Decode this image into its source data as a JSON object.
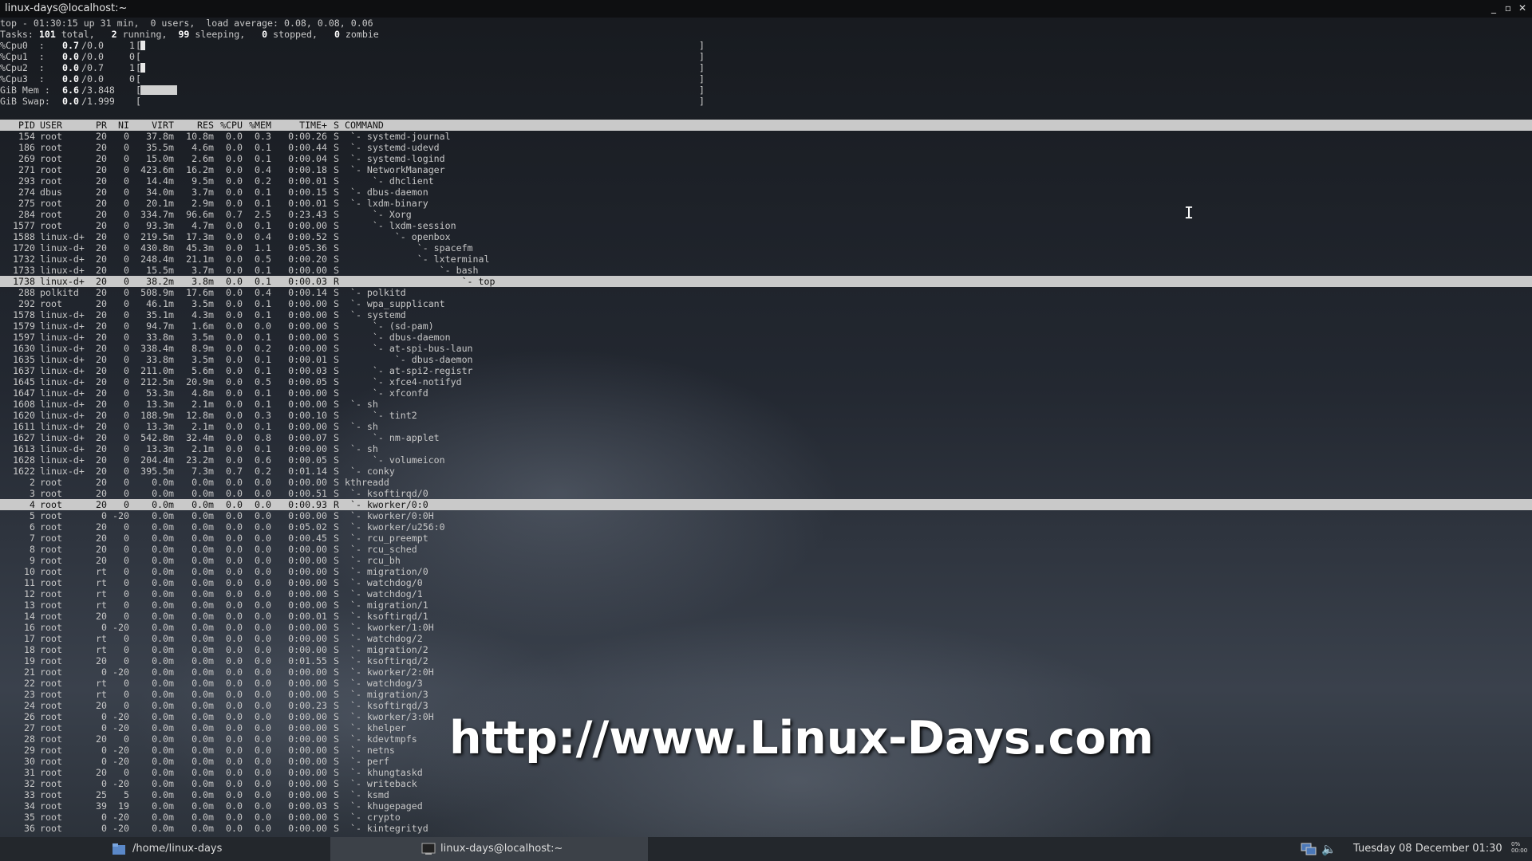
{
  "window": {
    "title": "linux-days@localhost:~"
  },
  "summary": {
    "line1": "top - 01:30:15 up 31 min,  0 users,  load average: 0.08, 0.08, 0.06",
    "tasks_label": "Tasks:",
    "tasks_total": "101",
    "tasks_total_label": "total,",
    "tasks_running": "2",
    "tasks_running_label": "running,",
    "tasks_sleeping": "99",
    "tasks_sleeping_label": "sleeping,",
    "tasks_stopped": "0",
    "tasks_stopped_label": "stopped,",
    "tasks_zombie": "0",
    "tasks_zombie_label": "zombie",
    "cpus": [
      {
        "label": "%Cpu0  :",
        "val": "0.7",
        "rest": "/0.0",
        "n": "1",
        "usage": 0.7
      },
      {
        "label": "%Cpu1  :",
        "val": "0.0",
        "rest": "/0.0",
        "n": "0",
        "usage": 0.0
      },
      {
        "label": "%Cpu2  :",
        "val": "0.0",
        "rest": "/0.7",
        "n": "1",
        "usage": 0.7
      },
      {
        "label": "%Cpu3  :",
        "val": "0.0",
        "rest": "/0.0",
        "n": "0",
        "usage": 0.0
      }
    ],
    "mem": {
      "label": "GiB Mem :",
      "val": "6.6",
      "rest": "/3.848",
      "usage_pct": 6.6
    },
    "swap": {
      "label": "GiB Swap:",
      "val": "0.0",
      "rest": "/1.999",
      "usage_pct": 0.0
    },
    "bracket_open": "[",
    "bracket_close": "]"
  },
  "columns": [
    "PID",
    "USER",
    "PR",
    "NI",
    "VIRT",
    "RES",
    "%CPU",
    "%MEM",
    "TIME+",
    "S",
    "COMMAND"
  ],
  "processes": [
    [
      "154",
      "root",
      "20",
      "0",
      "37.8m",
      "10.8m",
      "0.0",
      "0.3",
      "0:00.26",
      "S",
      " `- systemd-journal"
    ],
    [
      "186",
      "root",
      "20",
      "0",
      "35.5m",
      "4.6m",
      "0.0",
      "0.1",
      "0:00.44",
      "S",
      " `- systemd-udevd"
    ],
    [
      "269",
      "root",
      "20",
      "0",
      "15.0m",
      "2.6m",
      "0.0",
      "0.1",
      "0:00.04",
      "S",
      " `- systemd-logind"
    ],
    [
      "271",
      "root",
      "20",
      "0",
      "423.6m",
      "16.2m",
      "0.0",
      "0.4",
      "0:00.18",
      "S",
      " `- NetworkManager"
    ],
    [
      "293",
      "root",
      "20",
      "0",
      "14.4m",
      "9.5m",
      "0.0",
      "0.2",
      "0:00.01",
      "S",
      "     `- dhclient"
    ],
    [
      "274",
      "dbus",
      "20",
      "0",
      "34.0m",
      "3.7m",
      "0.0",
      "0.1",
      "0:00.15",
      "S",
      " `- dbus-daemon"
    ],
    [
      "275",
      "root",
      "20",
      "0",
      "20.1m",
      "2.9m",
      "0.0",
      "0.1",
      "0:00.01",
      "S",
      " `- lxdm-binary"
    ],
    [
      "284",
      "root",
      "20",
      "0",
      "334.7m",
      "96.6m",
      "0.7",
      "2.5",
      "0:23.43",
      "S",
      "     `- Xorg"
    ],
    [
      "1577",
      "root",
      "20",
      "0",
      "93.3m",
      "4.7m",
      "0.0",
      "0.1",
      "0:00.00",
      "S",
      "     `- lxdm-session"
    ],
    [
      "1588",
      "linux-d+",
      "20",
      "0",
      "219.5m",
      "17.3m",
      "0.0",
      "0.4",
      "0:00.52",
      "S",
      "         `- openbox"
    ],
    [
      "1720",
      "linux-d+",
      "20",
      "0",
      "430.8m",
      "45.3m",
      "0.0",
      "1.1",
      "0:05.36",
      "S",
      "             `- spacefm"
    ],
    [
      "1732",
      "linux-d+",
      "20",
      "0",
      "248.4m",
      "21.1m",
      "0.0",
      "0.5",
      "0:00.20",
      "S",
      "             `- lxterminal"
    ],
    [
      "1733",
      "linux-d+",
      "20",
      "0",
      "15.5m",
      "3.7m",
      "0.0",
      "0.1",
      "0:00.00",
      "S",
      "                 `- bash"
    ],
    [
      "1738",
      "linux-d+",
      "20",
      "0",
      "38.2m",
      "3.8m",
      "0.0",
      "0.1",
      "0:00.03",
      "R",
      "                     `- top"
    ],
    [
      "288",
      "polkitd",
      "20",
      "0",
      "508.9m",
      "17.6m",
      "0.0",
      "0.4",
      "0:00.14",
      "S",
      " `- polkitd"
    ],
    [
      "292",
      "root",
      "20",
      "0",
      "46.1m",
      "3.5m",
      "0.0",
      "0.1",
      "0:00.00",
      "S",
      " `- wpa_supplicant"
    ],
    [
      "1578",
      "linux-d+",
      "20",
      "0",
      "35.1m",
      "4.3m",
      "0.0",
      "0.1",
      "0:00.00",
      "S",
      " `- systemd"
    ],
    [
      "1579",
      "linux-d+",
      "20",
      "0",
      "94.7m",
      "1.6m",
      "0.0",
      "0.0",
      "0:00.00",
      "S",
      "     `- (sd-pam)"
    ],
    [
      "1597",
      "linux-d+",
      "20",
      "0",
      "33.8m",
      "3.5m",
      "0.0",
      "0.1",
      "0:00.00",
      "S",
      "     `- dbus-daemon"
    ],
    [
      "1630",
      "linux-d+",
      "20",
      "0",
      "338.4m",
      "8.9m",
      "0.0",
      "0.2",
      "0:00.00",
      "S",
      "     `- at-spi-bus-laun"
    ],
    [
      "1635",
      "linux-d+",
      "20",
      "0",
      "33.8m",
      "3.5m",
      "0.0",
      "0.1",
      "0:00.01",
      "S",
      "         `- dbus-daemon"
    ],
    [
      "1637",
      "linux-d+",
      "20",
      "0",
      "211.0m",
      "5.6m",
      "0.0",
      "0.1",
      "0:00.03",
      "S",
      "     `- at-spi2-registr"
    ],
    [
      "1645",
      "linux-d+",
      "20",
      "0",
      "212.5m",
      "20.9m",
      "0.0",
      "0.5",
      "0:00.05",
      "S",
      "     `- xfce4-notifyd"
    ],
    [
      "1647",
      "linux-d+",
      "20",
      "0",
      "53.3m",
      "4.8m",
      "0.0",
      "0.1",
      "0:00.00",
      "S",
      "     `- xfconfd"
    ],
    [
      "1608",
      "linux-d+",
      "20",
      "0",
      "13.3m",
      "2.1m",
      "0.0",
      "0.1",
      "0:00.00",
      "S",
      " `- sh"
    ],
    [
      "1620",
      "linux-d+",
      "20",
      "0",
      "188.9m",
      "12.8m",
      "0.0",
      "0.3",
      "0:00.10",
      "S",
      "     `- tint2"
    ],
    [
      "1611",
      "linux-d+",
      "20",
      "0",
      "13.3m",
      "2.1m",
      "0.0",
      "0.1",
      "0:00.00",
      "S",
      " `- sh"
    ],
    [
      "1627",
      "linux-d+",
      "20",
      "0",
      "542.8m",
      "32.4m",
      "0.0",
      "0.8",
      "0:00.07",
      "S",
      "     `- nm-applet"
    ],
    [
      "1613",
      "linux-d+",
      "20",
      "0",
      "13.3m",
      "2.1m",
      "0.0",
      "0.1",
      "0:00.00",
      "S",
      " `- sh"
    ],
    [
      "1628",
      "linux-d+",
      "20",
      "0",
      "204.4m",
      "23.2m",
      "0.0",
      "0.6",
      "0:00.05",
      "S",
      "     `- volumeicon"
    ],
    [
      "1622",
      "linux-d+",
      "20",
      "0",
      "395.5m",
      "7.3m",
      "0.7",
      "0.2",
      "0:01.14",
      "S",
      " `- conky"
    ],
    [
      "2",
      "root",
      "20",
      "0",
      "0.0m",
      "0.0m",
      "0.0",
      "0.0",
      "0:00.00",
      "S",
      "kthreadd"
    ],
    [
      "3",
      "root",
      "20",
      "0",
      "0.0m",
      "0.0m",
      "0.0",
      "0.0",
      "0:00.51",
      "S",
      " `- ksoftirqd/0"
    ],
    [
      "4",
      "root",
      "20",
      "0",
      "0.0m",
      "0.0m",
      "0.0",
      "0.0",
      "0:00.93",
      "R",
      " `- kworker/0:0"
    ],
    [
      "5",
      "root",
      "0",
      "-20",
      "0.0m",
      "0.0m",
      "0.0",
      "0.0",
      "0:00.00",
      "S",
      " `- kworker/0:0H"
    ],
    [
      "6",
      "root",
      "20",
      "0",
      "0.0m",
      "0.0m",
      "0.0",
      "0.0",
      "0:05.02",
      "S",
      " `- kworker/u256:0"
    ],
    [
      "7",
      "root",
      "20",
      "0",
      "0.0m",
      "0.0m",
      "0.0",
      "0.0",
      "0:00.45",
      "S",
      " `- rcu_preempt"
    ],
    [
      "8",
      "root",
      "20",
      "0",
      "0.0m",
      "0.0m",
      "0.0",
      "0.0",
      "0:00.00",
      "S",
      " `- rcu_sched"
    ],
    [
      "9",
      "root",
      "20",
      "0",
      "0.0m",
      "0.0m",
      "0.0",
      "0.0",
      "0:00.00",
      "S",
      " `- rcu_bh"
    ],
    [
      "10",
      "root",
      "rt",
      "0",
      "0.0m",
      "0.0m",
      "0.0",
      "0.0",
      "0:00.00",
      "S",
      " `- migration/0"
    ],
    [
      "11",
      "root",
      "rt",
      "0",
      "0.0m",
      "0.0m",
      "0.0",
      "0.0",
      "0:00.00",
      "S",
      " `- watchdog/0"
    ],
    [
      "12",
      "root",
      "rt",
      "0",
      "0.0m",
      "0.0m",
      "0.0",
      "0.0",
      "0:00.00",
      "S",
      " `- watchdog/1"
    ],
    [
      "13",
      "root",
      "rt",
      "0",
      "0.0m",
      "0.0m",
      "0.0",
      "0.0",
      "0:00.00",
      "S",
      " `- migration/1"
    ],
    [
      "14",
      "root",
      "20",
      "0",
      "0.0m",
      "0.0m",
      "0.0",
      "0.0",
      "0:00.01",
      "S",
      " `- ksoftirqd/1"
    ],
    [
      "16",
      "root",
      "0",
      "-20",
      "0.0m",
      "0.0m",
      "0.0",
      "0.0",
      "0:00.00",
      "S",
      " `- kworker/1:0H"
    ],
    [
      "17",
      "root",
      "rt",
      "0",
      "0.0m",
      "0.0m",
      "0.0",
      "0.0",
      "0:00.00",
      "S",
      " `- watchdog/2"
    ],
    [
      "18",
      "root",
      "rt",
      "0",
      "0.0m",
      "0.0m",
      "0.0",
      "0.0",
      "0:00.00",
      "S",
      " `- migration/2"
    ],
    [
      "19",
      "root",
      "20",
      "0",
      "0.0m",
      "0.0m",
      "0.0",
      "0.0",
      "0:01.55",
      "S",
      " `- ksoftirqd/2"
    ],
    [
      "21",
      "root",
      "0",
      "-20",
      "0.0m",
      "0.0m",
      "0.0",
      "0.0",
      "0:00.00",
      "S",
      " `- kworker/2:0H"
    ],
    [
      "22",
      "root",
      "rt",
      "0",
      "0.0m",
      "0.0m",
      "0.0",
      "0.0",
      "0:00.00",
      "S",
      " `- watchdog/3"
    ],
    [
      "23",
      "root",
      "rt",
      "0",
      "0.0m",
      "0.0m",
      "0.0",
      "0.0",
      "0:00.00",
      "S",
      " `- migration/3"
    ],
    [
      "24",
      "root",
      "20",
      "0",
      "0.0m",
      "0.0m",
      "0.0",
      "0.0",
      "0:00.23",
      "S",
      " `- ksoftirqd/3"
    ],
    [
      "26",
      "root",
      "0",
      "-20",
      "0.0m",
      "0.0m",
      "0.0",
      "0.0",
      "0:00.00",
      "S",
      " `- kworker/3:0H"
    ],
    [
      "27",
      "root",
      "0",
      "-20",
      "0.0m",
      "0.0m",
      "0.0",
      "0.0",
      "0:00.00",
      "S",
      " `- khelper"
    ],
    [
      "28",
      "root",
      "20",
      "0",
      "0.0m",
      "0.0m",
      "0.0",
      "0.0",
      "0:00.00",
      "S",
      " `- kdevtmpfs"
    ],
    [
      "29",
      "root",
      "0",
      "-20",
      "0.0m",
      "0.0m",
      "0.0",
      "0.0",
      "0:00.00",
      "S",
      " `- netns"
    ],
    [
      "30",
      "root",
      "0",
      "-20",
      "0.0m",
      "0.0m",
      "0.0",
      "0.0",
      "0:00.00",
      "S",
      " `- perf"
    ],
    [
      "31",
      "root",
      "20",
      "0",
      "0.0m",
      "0.0m",
      "0.0",
      "0.0",
      "0:00.00",
      "S",
      " `- khungtaskd"
    ],
    [
      "32",
      "root",
      "0",
      "-20",
      "0.0m",
      "0.0m",
      "0.0",
      "0.0",
      "0:00.00",
      "S",
      " `- writeback"
    ],
    [
      "33",
      "root",
      "25",
      "5",
      "0.0m",
      "0.0m",
      "0.0",
      "0.0",
      "0:00.00",
      "S",
      " `- ksmd"
    ],
    [
      "34",
      "root",
      "39",
      "19",
      "0.0m",
      "0.0m",
      "0.0",
      "0.0",
      "0:00.03",
      "S",
      " `- khugepaged"
    ],
    [
      "35",
      "root",
      "0",
      "-20",
      "0.0m",
      "0.0m",
      "0.0",
      "0.0",
      "0:00.00",
      "S",
      " `- crypto"
    ],
    [
      "36",
      "root",
      "0",
      "-20",
      "0.0m",
      "0.0m",
      "0.0",
      "0.0",
      "0:00.00",
      "S",
      " `- kintegrityd"
    ]
  ],
  "highlighted_pids": [
    "1738",
    "4"
  ],
  "watermark": "http://www.Linux-Days.com",
  "taskbar": {
    "task1_label": "/home/linux-days",
    "task2_label": "linux-days@localhost:~",
    "clock": "Tuesday 08 December 01:30",
    "tray_tiny_1": "0%",
    "tray_tiny_2": "00:00"
  },
  "icons": {
    "folder": "folder-icon",
    "terminal": "terminal-icon",
    "network": "network-icon",
    "volume": "volume-icon"
  },
  "colors": {
    "header_bg": "#c9c9c9",
    "taskbar_bg": "#23272c",
    "titlebar_bg": "#0e0f11",
    "watermark": "#ffffff"
  }
}
